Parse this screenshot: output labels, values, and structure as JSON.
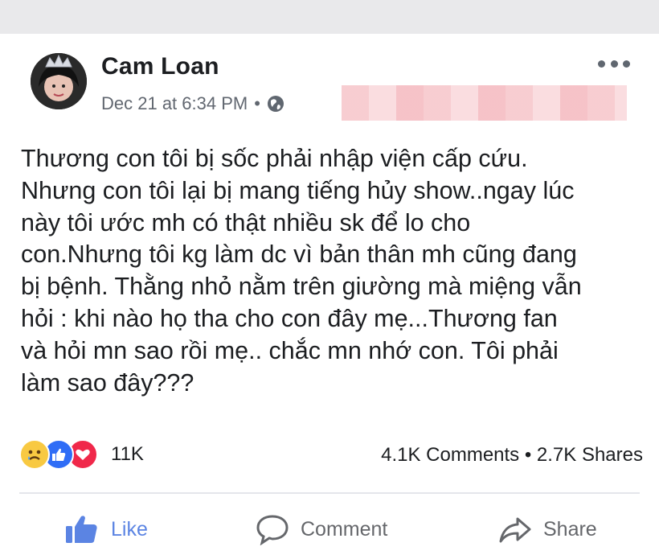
{
  "post": {
    "author": "Cam Loan",
    "timestamp": "Dec 21 at 6:34 PM",
    "separator": "•",
    "privacy_icon": "globe-icon",
    "text": "Thương con tôi bị sốc phải nhập viện cấp cứu.\nNhưng con tôi lại bị  mang tiếng hủy show..ngay lúc\nnày tôi ước mh có thật nhiều sk để lo cho\ncon.Nhưng tôi kg làm dc vì bản thân mh cũng đang\nbị bệnh. Thằng nhỏ nằm trên giường mà miệng vẫn\nhỏi : khi nào họ  tha cho con đây mẹ...Thương fan\nvà hỏi mn sao rồi mẹ.. chắc mn nhớ con. Tôi phải\nlàm sao đây???"
  },
  "engagement": {
    "reaction_icons": [
      "sad-reaction-icon",
      "like-reaction-icon",
      "love-reaction-icon"
    ],
    "reaction_count": "11K",
    "comments_shares": "4.1K Comments • 2.7K Shares"
  },
  "actions": {
    "like_label": "Like",
    "comment_label": "Comment",
    "share_label": "Share"
  },
  "colors": {
    "like_active": "#5b84e3",
    "text": "#1c1e21",
    "secondary_text": "#65676b",
    "redaction": "#f6c4c9"
  }
}
